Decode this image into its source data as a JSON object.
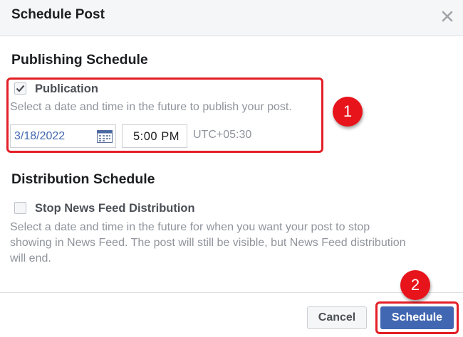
{
  "dialog": {
    "title": "Schedule Post",
    "close_icon": "close-icon"
  },
  "publishing": {
    "title": "Publishing Schedule",
    "checkbox_label": "Publication",
    "checked": true,
    "helper": "Select a date and time in the future to publish your post.",
    "date_value": "3/18/2022",
    "calendar_icon": "calendar-icon",
    "time_value": "5:00 PM",
    "timezone": "UTC+05:30"
  },
  "distribution": {
    "title": "Distribution Schedule",
    "checkbox_label": "Stop News Feed Distribution",
    "checked": false,
    "helper_lines": [
      "Select a date and time in the future for when you want your post to stop",
      "showing in News Feed. The post will still be visible, but News Feed distribution",
      "will end."
    ]
  },
  "footer": {
    "cancel_label": "Cancel",
    "schedule_label": "Schedule"
  },
  "annotations": {
    "step1": "1",
    "step2": "2",
    "highlight_color": "#e41e26"
  },
  "colors": {
    "primary": "#4267b2",
    "header_bg": "#f5f6f7"
  }
}
